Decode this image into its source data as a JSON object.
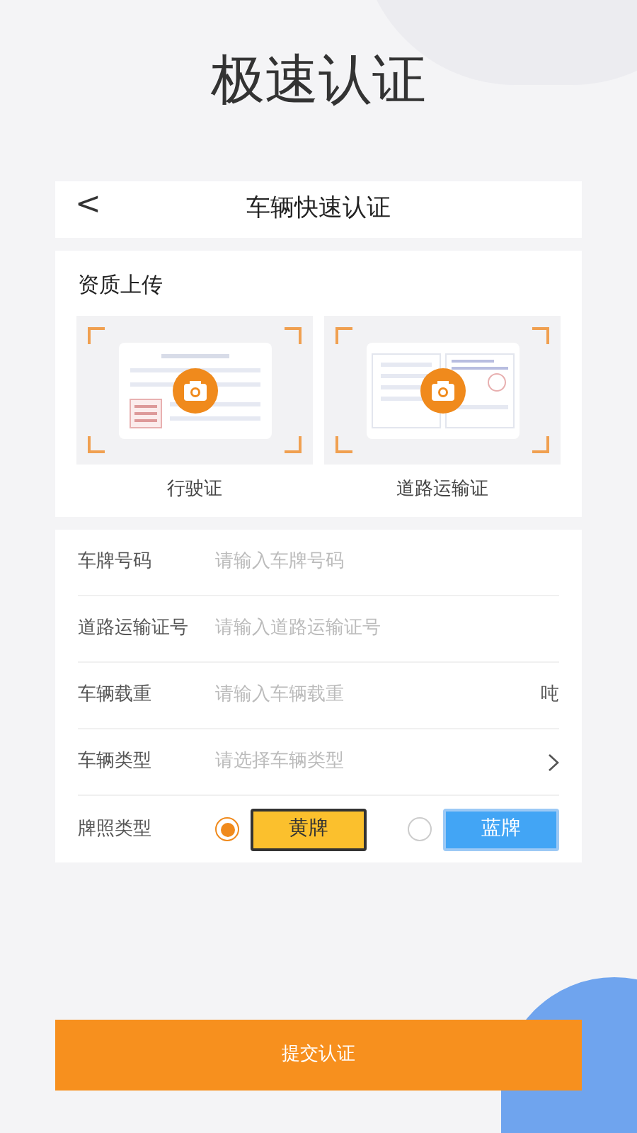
{
  "page_title": "极速认证",
  "header": {
    "back_icon": "<",
    "title": "车辆快速认证"
  },
  "upload": {
    "title": "资质上传",
    "items": [
      {
        "label": "行驶证",
        "kind": "license"
      },
      {
        "label": "道路运输证",
        "kind": "permit"
      }
    ]
  },
  "fields": [
    {
      "kind": "text",
      "label": "车牌号码",
      "placeholder": "请输入车牌号码"
    },
    {
      "kind": "text",
      "label": "道路运输证号",
      "placeholder": "请输入道路运输证号"
    },
    {
      "kind": "text",
      "label": "车辆载重",
      "placeholder": "请输入车辆载重",
      "suffix": "吨"
    },
    {
      "kind": "select",
      "label": "车辆类型",
      "placeholder": "请选择车辆类型"
    },
    {
      "kind": "radio",
      "label": "牌照类型",
      "options": [
        {
          "label": "黄牌",
          "selected": true,
          "color": "#fbc02d"
        },
        {
          "label": "蓝牌",
          "selected": false,
          "color": "#42a5f5"
        }
      ]
    }
  ],
  "submit": "提交认证"
}
